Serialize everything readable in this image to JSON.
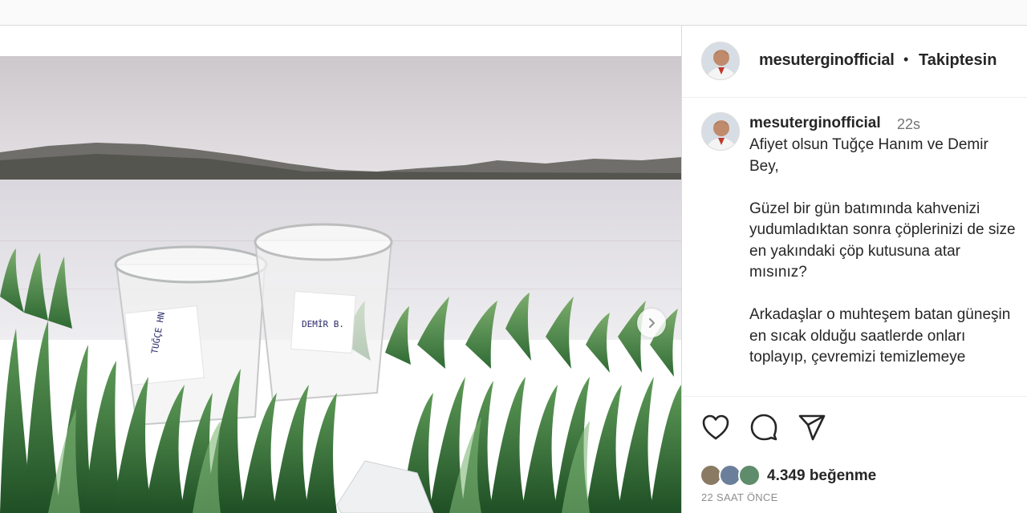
{
  "post": {
    "username": "mesuterginofficial",
    "separator": "•",
    "follow_status": "Takiptesin"
  },
  "caption": {
    "username": "mesuterginofficial",
    "time_ago": "22s",
    "lines": [
      "Afiyet olsun Tuğçe Hanım ve Demir",
      "Bey,",
      "",
      "Güzel bir gün batımında kahvenizi",
      "yudumladıktan sonra çöplerinizi de size",
      "en yakındaki çöp kutusuna atar",
      "mısınız?",
      "",
      "Arkadaşlar o muhteşem batan güneşin",
      "en sıcak olduğu saatlerde onları",
      "toplayıp, çevremizi temizlemeye"
    ]
  },
  "actions": {
    "like_icon": "heart-icon",
    "comment_icon": "comment-icon",
    "share_icon": "share-icon"
  },
  "likes": {
    "count_text": "4.349 beğenme"
  },
  "timestamp": "22 SAAT ÖNCE",
  "photo": {
    "cup_left_label": [
      "TUĞÇE HN"
    ],
    "cup_right_label": [
      "DEMİR B."
    ]
  },
  "colors": {
    "text": "#262626",
    "secondary": "#737373",
    "border": "#dbdbdb",
    "sky": "#d8d4d6",
    "water": "#e4e2e6",
    "plants": "#4e8a4a"
  }
}
